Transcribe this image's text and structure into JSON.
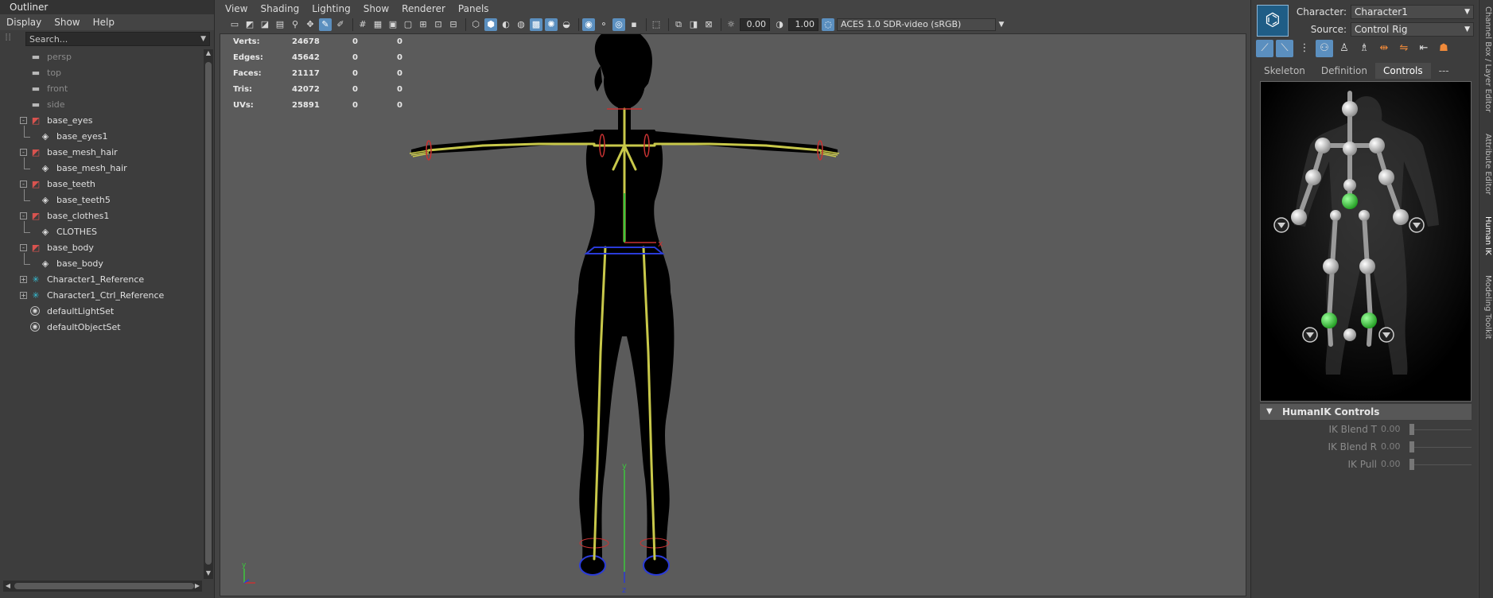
{
  "outliner": {
    "title": "Outliner",
    "menu": [
      "Display",
      "Show",
      "Help"
    ],
    "search_placeholder": "Search...",
    "items": [
      {
        "label": "persp",
        "icon": "camera-icon",
        "dim": true,
        "depth": 0
      },
      {
        "label": "top",
        "icon": "camera-icon",
        "dim": true,
        "depth": 0
      },
      {
        "label": "front",
        "icon": "camera-icon",
        "dim": true,
        "depth": 0
      },
      {
        "label": "side",
        "icon": "camera-icon",
        "dim": true,
        "depth": 0
      },
      {
        "label": "base_eyes",
        "icon": "mesh-transform-icon",
        "expand": "-",
        "depth": 0
      },
      {
        "label": "base_eyes1",
        "icon": "mesh-shape-icon",
        "depth": 1
      },
      {
        "label": "base_mesh_hair",
        "icon": "mesh-transform-icon",
        "expand": "-",
        "depth": 0
      },
      {
        "label": "base_mesh_hair",
        "icon": "mesh-shape-icon",
        "depth": 1
      },
      {
        "label": "base_teeth",
        "icon": "mesh-transform-icon",
        "expand": "-",
        "depth": 0
      },
      {
        "label": "base_teeth5",
        "icon": "mesh-shape-icon",
        "depth": 1
      },
      {
        "label": "base_clothes1",
        "icon": "mesh-transform-icon",
        "expand": "-",
        "depth": 0
      },
      {
        "label": "CLOTHES",
        "icon": "mesh-shape-icon",
        "depth": 1
      },
      {
        "label": "base_body",
        "icon": "mesh-transform-icon",
        "expand": "-",
        "depth": 0
      },
      {
        "label": "base_body",
        "icon": "mesh-shape-icon",
        "depth": 1
      },
      {
        "label": "Character1_Reference",
        "icon": "joint-icon",
        "expand": "+",
        "depth": 0
      },
      {
        "label": "Character1_Ctrl_Reference",
        "icon": "joint-icon",
        "expand": "+",
        "depth": 0
      },
      {
        "label": "defaultLightSet",
        "icon": "set-icon",
        "depth": 0
      },
      {
        "label": "defaultObjectSet",
        "icon": "set-icon",
        "depth": 0
      }
    ]
  },
  "viewport": {
    "menu": [
      "View",
      "Shading",
      "Lighting",
      "Show",
      "Renderer",
      "Panels"
    ],
    "exposure": "0.00",
    "gamma": "1.00",
    "color_space": "ACES 1.0 SDR-video (sRGB)",
    "hud": [
      {
        "label": "Verts:",
        "v1": "24678",
        "v2": "0",
        "v3": "0"
      },
      {
        "label": "Edges:",
        "v1": "45642",
        "v2": "0",
        "v3": "0"
      },
      {
        "label": "Faces:",
        "v1": "21117",
        "v2": "0",
        "v3": "0"
      },
      {
        "label": "Tris:",
        "v1": "42072",
        "v2": "0",
        "v3": "0"
      },
      {
        "label": "UVs:",
        "v1": "25891",
        "v2": "0",
        "v3": "0"
      }
    ],
    "axis_labels": {
      "y": "y",
      "x": "x",
      "z": "z"
    }
  },
  "humanik": {
    "character_label": "Character:",
    "character_value": "Character1",
    "source_label": "Source:",
    "source_value": "Control Rig",
    "tabs": [
      "Skeleton",
      "Definition",
      "Controls",
      "---"
    ],
    "active_tab": "Controls",
    "section_title": "HumanIK Controls",
    "ik_rows": [
      {
        "label": "IK Blend T",
        "value": "0.00"
      },
      {
        "label": "IK Blend R",
        "value": "0.00"
      },
      {
        "label": "IK Pull",
        "value": "0.00"
      }
    ],
    "colors": {
      "effector_active": "#33cc33",
      "node": "#d8d8d8",
      "accent": "#5b8fbf"
    }
  },
  "side_tabs": [
    "Channel Box / Layer Editor",
    "Attribute Editor",
    "Human IK",
    "Modeling Toolkit"
  ]
}
